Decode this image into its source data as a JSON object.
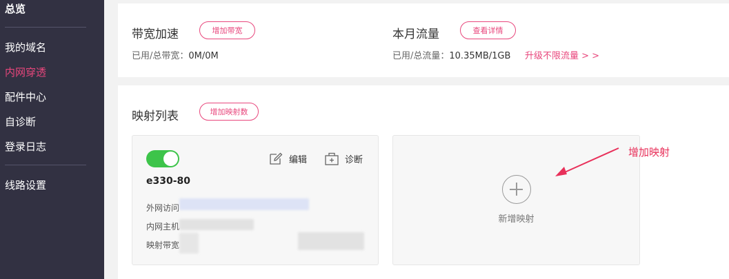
{
  "sidebar": {
    "title": "总览",
    "items": [
      "我的域名",
      "内网穿透",
      "配件中心",
      "自诊断",
      "登录日志"
    ],
    "active_item": "内网穿透",
    "bottom_item": "线路设置"
  },
  "bandwidth": {
    "title": "带宽加速",
    "button": "增加带宽",
    "stat_label": "已用/总带宽：",
    "stat_value": "0M/0M"
  },
  "traffic": {
    "title": "本月流量",
    "button": "查看详情",
    "stat_label": "已用/总流量：",
    "stat_value": "10.35MB/1GB",
    "upgrade_link": "升级不限流量 > >"
  },
  "mapping_list": {
    "title": "映射列表",
    "add_button": "增加映射数",
    "cards": [
      {
        "enabled": true,
        "name": "e330-80",
        "edit_label": "编辑",
        "diagnose_label": "诊断",
        "external_label": "外网访问",
        "internal_label": "内网主机",
        "bandwidth_label": "映射带宽"
      }
    ],
    "new_card_label": "新增映射"
  },
  "annotation": {
    "text": "增加映射",
    "color": "#e8305a"
  },
  "colors": {
    "accent": "#e8467c",
    "sidebar_bg": "#323142",
    "toggle_on": "#3dc44a"
  }
}
